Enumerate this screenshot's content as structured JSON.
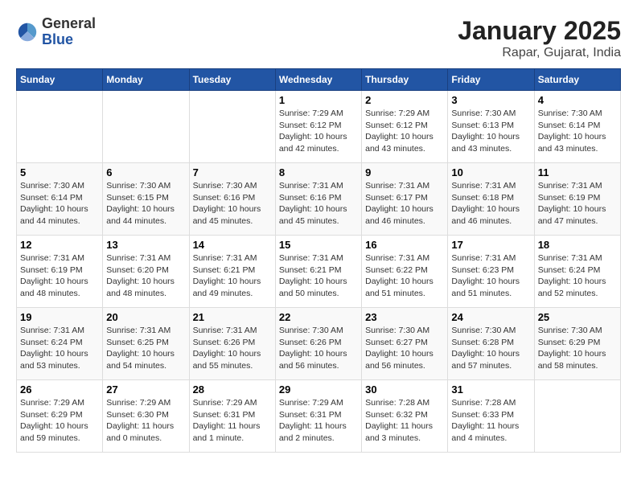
{
  "logo": {
    "general": "General",
    "blue": "Blue"
  },
  "title": "January 2025",
  "subtitle": "Rapar, Gujarat, India",
  "weekdays": [
    "Sunday",
    "Monday",
    "Tuesday",
    "Wednesday",
    "Thursday",
    "Friday",
    "Saturday"
  ],
  "weeks": [
    [
      {
        "day": "",
        "info": ""
      },
      {
        "day": "",
        "info": ""
      },
      {
        "day": "",
        "info": ""
      },
      {
        "day": "1",
        "info": "Sunrise: 7:29 AM\nSunset: 6:12 PM\nDaylight: 10 hours\nand 42 minutes."
      },
      {
        "day": "2",
        "info": "Sunrise: 7:29 AM\nSunset: 6:12 PM\nDaylight: 10 hours\nand 43 minutes."
      },
      {
        "day": "3",
        "info": "Sunrise: 7:30 AM\nSunset: 6:13 PM\nDaylight: 10 hours\nand 43 minutes."
      },
      {
        "day": "4",
        "info": "Sunrise: 7:30 AM\nSunset: 6:14 PM\nDaylight: 10 hours\nand 43 minutes."
      }
    ],
    [
      {
        "day": "5",
        "info": "Sunrise: 7:30 AM\nSunset: 6:14 PM\nDaylight: 10 hours\nand 44 minutes."
      },
      {
        "day": "6",
        "info": "Sunrise: 7:30 AM\nSunset: 6:15 PM\nDaylight: 10 hours\nand 44 minutes."
      },
      {
        "day": "7",
        "info": "Sunrise: 7:30 AM\nSunset: 6:16 PM\nDaylight: 10 hours\nand 45 minutes."
      },
      {
        "day": "8",
        "info": "Sunrise: 7:31 AM\nSunset: 6:16 PM\nDaylight: 10 hours\nand 45 minutes."
      },
      {
        "day": "9",
        "info": "Sunrise: 7:31 AM\nSunset: 6:17 PM\nDaylight: 10 hours\nand 46 minutes."
      },
      {
        "day": "10",
        "info": "Sunrise: 7:31 AM\nSunset: 6:18 PM\nDaylight: 10 hours\nand 46 minutes."
      },
      {
        "day": "11",
        "info": "Sunrise: 7:31 AM\nSunset: 6:19 PM\nDaylight: 10 hours\nand 47 minutes."
      }
    ],
    [
      {
        "day": "12",
        "info": "Sunrise: 7:31 AM\nSunset: 6:19 PM\nDaylight: 10 hours\nand 48 minutes."
      },
      {
        "day": "13",
        "info": "Sunrise: 7:31 AM\nSunset: 6:20 PM\nDaylight: 10 hours\nand 48 minutes."
      },
      {
        "day": "14",
        "info": "Sunrise: 7:31 AM\nSunset: 6:21 PM\nDaylight: 10 hours\nand 49 minutes."
      },
      {
        "day": "15",
        "info": "Sunrise: 7:31 AM\nSunset: 6:21 PM\nDaylight: 10 hours\nand 50 minutes."
      },
      {
        "day": "16",
        "info": "Sunrise: 7:31 AM\nSunset: 6:22 PM\nDaylight: 10 hours\nand 51 minutes."
      },
      {
        "day": "17",
        "info": "Sunrise: 7:31 AM\nSunset: 6:23 PM\nDaylight: 10 hours\nand 51 minutes."
      },
      {
        "day": "18",
        "info": "Sunrise: 7:31 AM\nSunset: 6:24 PM\nDaylight: 10 hours\nand 52 minutes."
      }
    ],
    [
      {
        "day": "19",
        "info": "Sunrise: 7:31 AM\nSunset: 6:24 PM\nDaylight: 10 hours\nand 53 minutes."
      },
      {
        "day": "20",
        "info": "Sunrise: 7:31 AM\nSunset: 6:25 PM\nDaylight: 10 hours\nand 54 minutes."
      },
      {
        "day": "21",
        "info": "Sunrise: 7:31 AM\nSunset: 6:26 PM\nDaylight: 10 hours\nand 55 minutes."
      },
      {
        "day": "22",
        "info": "Sunrise: 7:30 AM\nSunset: 6:26 PM\nDaylight: 10 hours\nand 56 minutes."
      },
      {
        "day": "23",
        "info": "Sunrise: 7:30 AM\nSunset: 6:27 PM\nDaylight: 10 hours\nand 56 minutes."
      },
      {
        "day": "24",
        "info": "Sunrise: 7:30 AM\nSunset: 6:28 PM\nDaylight: 10 hours\nand 57 minutes."
      },
      {
        "day": "25",
        "info": "Sunrise: 7:30 AM\nSunset: 6:29 PM\nDaylight: 10 hours\nand 58 minutes."
      }
    ],
    [
      {
        "day": "26",
        "info": "Sunrise: 7:29 AM\nSunset: 6:29 PM\nDaylight: 10 hours\nand 59 minutes."
      },
      {
        "day": "27",
        "info": "Sunrise: 7:29 AM\nSunset: 6:30 PM\nDaylight: 11 hours\nand 0 minutes."
      },
      {
        "day": "28",
        "info": "Sunrise: 7:29 AM\nSunset: 6:31 PM\nDaylight: 11 hours\nand 1 minute."
      },
      {
        "day": "29",
        "info": "Sunrise: 7:29 AM\nSunset: 6:31 PM\nDaylight: 11 hours\nand 2 minutes."
      },
      {
        "day": "30",
        "info": "Sunrise: 7:28 AM\nSunset: 6:32 PM\nDaylight: 11 hours\nand 3 minutes."
      },
      {
        "day": "31",
        "info": "Sunrise: 7:28 AM\nSunset: 6:33 PM\nDaylight: 11 hours\nand 4 minutes."
      },
      {
        "day": "",
        "info": ""
      }
    ]
  ]
}
